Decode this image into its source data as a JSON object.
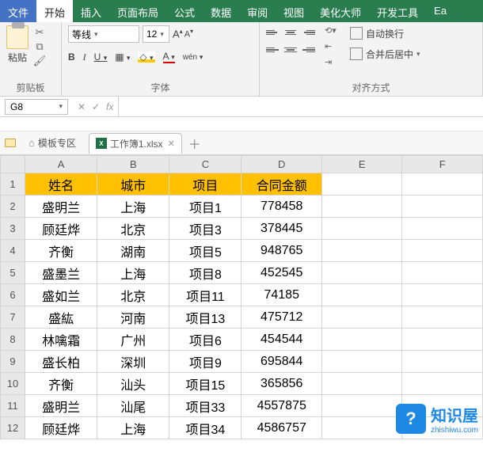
{
  "menu": {
    "file": "文件",
    "tabs": [
      "开始",
      "插入",
      "页面布局",
      "公式",
      "数据",
      "审阅",
      "视图",
      "美化大师",
      "开发工具",
      "Ea"
    ]
  },
  "ribbon": {
    "clipboard": {
      "paste": "粘贴",
      "label": "剪贴板"
    },
    "font": {
      "name": "等线",
      "size": "12",
      "bold": "B",
      "italic": "I",
      "underline": "U",
      "a_up": "A",
      "a_dn": "A",
      "a_bg": "A",
      "wen": "wén",
      "label": "字体"
    },
    "align": {
      "wrap": "自动换行",
      "merge": "合并后居中",
      "label": "对齐方式"
    }
  },
  "namebox": "G8",
  "doctabs": {
    "templates": "模板专区",
    "book": "工作簿1.xlsx"
  },
  "columns": [
    "A",
    "B",
    "C",
    "D",
    "E",
    "F"
  ],
  "headers": [
    "姓名",
    "城市",
    "项目",
    "合同金额"
  ],
  "rows": [
    [
      "盛明兰",
      "上海",
      "项目1",
      "778458"
    ],
    [
      "顾廷烨",
      "北京",
      "项目3",
      "378445"
    ],
    [
      "齐衡",
      "湖南",
      "项目5",
      "948765"
    ],
    [
      "盛墨兰",
      "上海",
      "项目8",
      "452545"
    ],
    [
      "盛如兰",
      "北京",
      "项目11",
      "74185"
    ],
    [
      "盛紘",
      "河南",
      "项目13",
      "475712"
    ],
    [
      "林噙霜",
      "广州",
      "项目6",
      "454544"
    ],
    [
      "盛长柏",
      "深圳",
      "项目9",
      "695844"
    ],
    [
      "齐衡",
      "汕头",
      "项目15",
      "365856"
    ],
    [
      "盛明兰",
      "汕尾",
      "项目33",
      "4557875"
    ],
    [
      "顾廷烨",
      "上海",
      "项目34",
      "4586757"
    ]
  ],
  "watermark": {
    "brand": "知识屋",
    "url": "zhishiwu.com"
  },
  "chart_data": {
    "type": "table",
    "columns": [
      "姓名",
      "城市",
      "项目",
      "合同金额"
    ],
    "data": [
      [
        "盛明兰",
        "上海",
        "项目1",
        778458
      ],
      [
        "顾廷烨",
        "北京",
        "项目3",
        378445
      ],
      [
        "齐衡",
        "湖南",
        "项目5",
        948765
      ],
      [
        "盛墨兰",
        "上海",
        "项目8",
        452545
      ],
      [
        "盛如兰",
        "北京",
        "项目11",
        74185
      ],
      [
        "盛紘",
        "河南",
        "项目13",
        475712
      ],
      [
        "林噙霜",
        "广州",
        "项目6",
        454544
      ],
      [
        "盛长柏",
        "深圳",
        "项目9",
        695844
      ],
      [
        "齐衡",
        "汕头",
        "项目15",
        365856
      ],
      [
        "盛明兰",
        "汕尾",
        "项目33",
        4557875
      ],
      [
        "顾廷烨",
        "上海",
        "项目34",
        4586757
      ]
    ]
  }
}
